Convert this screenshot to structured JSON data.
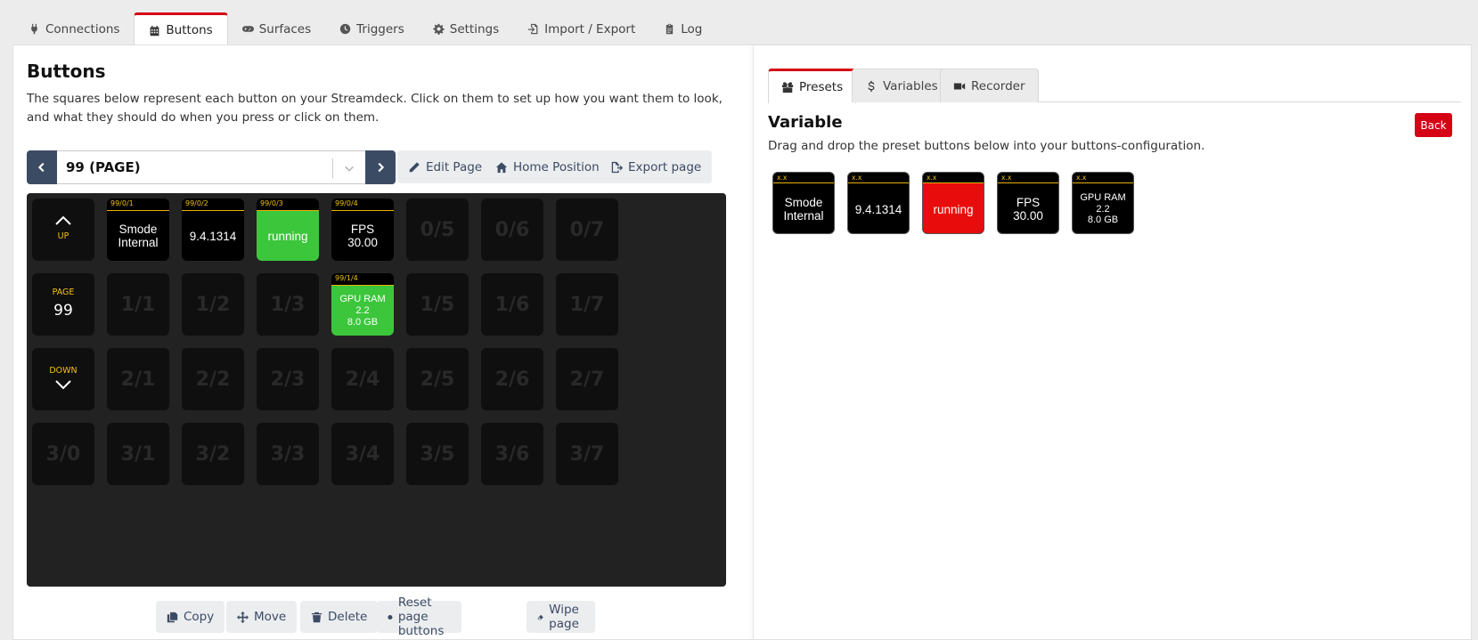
{
  "top_tabs": [
    {
      "label": "Connections",
      "icon": "plug-icon"
    },
    {
      "label": "Buttons",
      "icon": "calendar-grid-icon",
      "active": true
    },
    {
      "label": "Surfaces",
      "icon": "gamepad-icon"
    },
    {
      "label": "Triggers",
      "icon": "clock-icon"
    },
    {
      "label": "Settings",
      "icon": "gear-icon"
    },
    {
      "label": "Import / Export",
      "icon": "file-import-icon"
    },
    {
      "label": "Log",
      "icon": "clipboard-icon"
    }
  ],
  "buttons_panel": {
    "title": "Buttons",
    "description": "The squares below represent each button on your Streamdeck. Click on them to set up how you want them to look, and what they should do when you press or click on them.",
    "page_select_value": "99 (PAGE)",
    "edit_page_label": "Edit Page",
    "home_position_label": "Home Position",
    "export_page_label": "Export page"
  },
  "grid": {
    "up_label": "UP",
    "page_label": "PAGE",
    "page_number": "99",
    "down_label": "DOWN",
    "configured": {
      "b01": {
        "header": "99/0/1",
        "text": "Smode\nInternal",
        "bg": "#000000"
      },
      "b02": {
        "header": "99/0/2",
        "text": "9.4.1314",
        "bg": "#000000"
      },
      "b03": {
        "header": "99/0/3",
        "text": "running",
        "bg": "#3cc63c"
      },
      "b04": {
        "header": "99/0/4",
        "text": "FPS\n30.00",
        "bg": "#000000"
      },
      "b14": {
        "header": "99/1/4",
        "text": "GPU RAM\n2.2\n8.0 GB",
        "bg": "#3cc63c"
      }
    },
    "empty": {
      "e05": "0/5",
      "e06": "0/6",
      "e07": "0/7",
      "e11": "1/1",
      "e12": "1/2",
      "e13": "1/3",
      "e15": "1/5",
      "e16": "1/6",
      "e17": "1/7",
      "e21": "2/1",
      "e22": "2/2",
      "e23": "2/3",
      "e24": "2/4",
      "e25": "2/5",
      "e26": "2/6",
      "e27": "2/7",
      "e30": "3/0",
      "e31": "3/1",
      "e32": "3/2",
      "e33": "3/3",
      "e34": "3/4",
      "e35": "3/5",
      "e36": "3/6",
      "e37": "3/7"
    }
  },
  "bottom_actions": {
    "copy": "Copy",
    "move": "Move",
    "delete": "Delete",
    "reset": "Reset page buttons",
    "wipe": "Wipe page"
  },
  "right_panel": {
    "tabs": {
      "presets": "Presets",
      "variables": "Variables",
      "recorder": "Recorder"
    },
    "title": "Variable",
    "description": "Drag and drop the preset buttons below into your buttons-configuration.",
    "back_label": "Back",
    "presets": {
      "p1": {
        "header": "x.x",
        "text": "Smode\nInternal"
      },
      "p2": {
        "header": "x.x",
        "text": "9.4.1314"
      },
      "p3": {
        "header": "x.x",
        "text": "running",
        "bg": "#e80c0c"
      },
      "p4": {
        "header": "x.x",
        "text": "FPS\n30.00"
      },
      "p5": {
        "header": "x.x",
        "text": "GPU RAM\n2.2\n8.0 GB"
      }
    }
  },
  "colors": {
    "accent": "#d50215",
    "nav_blue": "#3c4b64",
    "header_yellow": "#f1c10f",
    "green": "#3cc63c",
    "red": "#e80c0c"
  }
}
